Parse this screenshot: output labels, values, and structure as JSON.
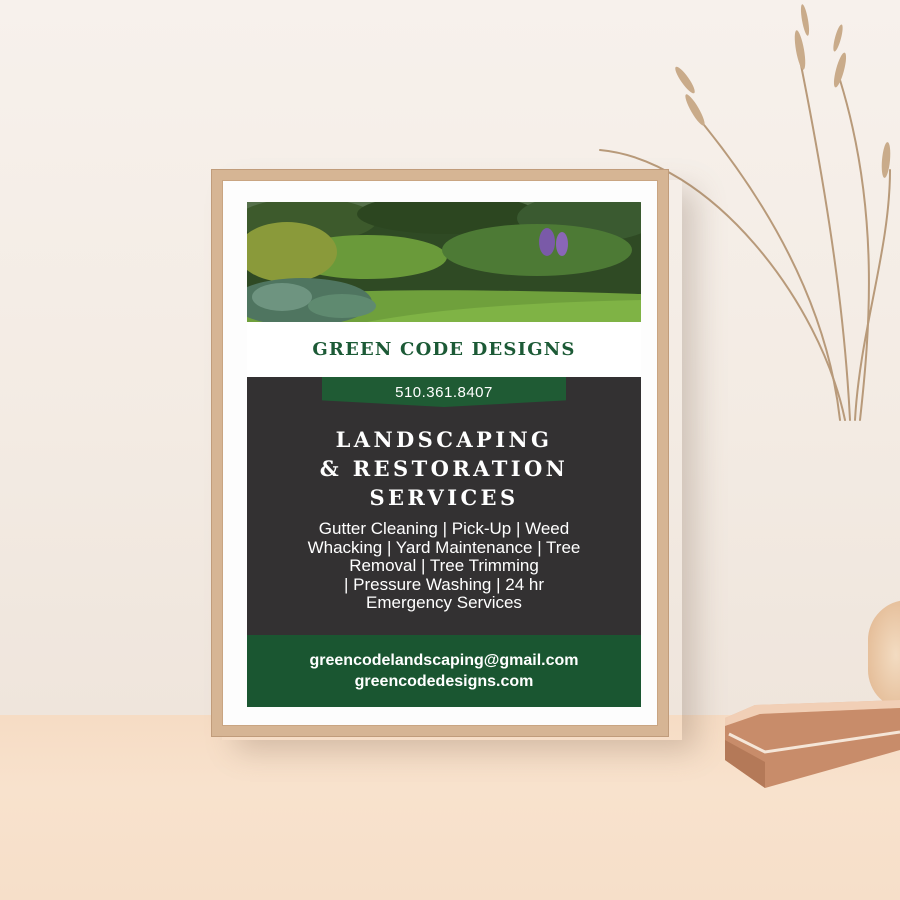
{
  "poster": {
    "brand": "GREEN CODE DESIGNS",
    "phone": "510.361.8407",
    "headline": [
      "LANDSCAPING",
      "& RESTORATION",
      "SERVICES"
    ],
    "services": [
      "Gutter Cleaning | Pick-Up | Weed",
      "Whacking | Yard Maintenance | Tree",
      "Removal | Tree Trimming",
      "| Pressure Washing | 24 hr",
      "Emergency Services"
    ],
    "email": "greencodelandscaping@gmail.com",
    "website": "greencodedesigns.com"
  },
  "colors": {
    "brand_green": "#1c5a36",
    "footer_green": "#1a5631",
    "charcoal": "#333132",
    "frame_wood": "#d6b594",
    "wall": "#f4ece4"
  },
  "icons": [
    "garden-photo",
    "dried-grass-decor",
    "vase-decor",
    "book-decor"
  ]
}
